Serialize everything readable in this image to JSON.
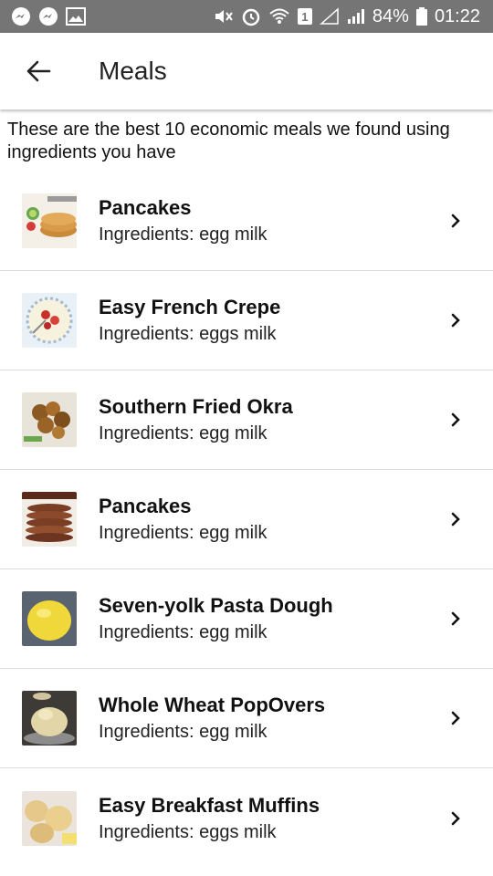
{
  "status_bar": {
    "battery": "84%",
    "time": "01:22",
    "sim": "1"
  },
  "app_bar": {
    "title": "Meals"
  },
  "intro_text": "These are the best 10 economic meals we found using ingredients you have",
  "meals": [
    {
      "name": "Pancakes",
      "ingredients": "Ingredients: egg milk"
    },
    {
      "name": "Easy French Crepe",
      "ingredients": "Ingredients: eggs milk"
    },
    {
      "name": "Southern Fried Okra",
      "ingredients": "Ingredients: egg milk"
    },
    {
      "name": "Pancakes",
      "ingredients": "Ingredients: egg milk"
    },
    {
      "name": "Seven-yolk Pasta Dough",
      "ingredients": "Ingredients: egg milk"
    },
    {
      "name": "Whole Wheat PopOvers",
      "ingredients": "Ingredients: egg milk"
    },
    {
      "name": "Easy Breakfast Muffins",
      "ingredients": "Ingredients: eggs milk"
    }
  ],
  "icons": {
    "back": "arrow-left-icon",
    "chevron": "chevron-right-icon"
  }
}
